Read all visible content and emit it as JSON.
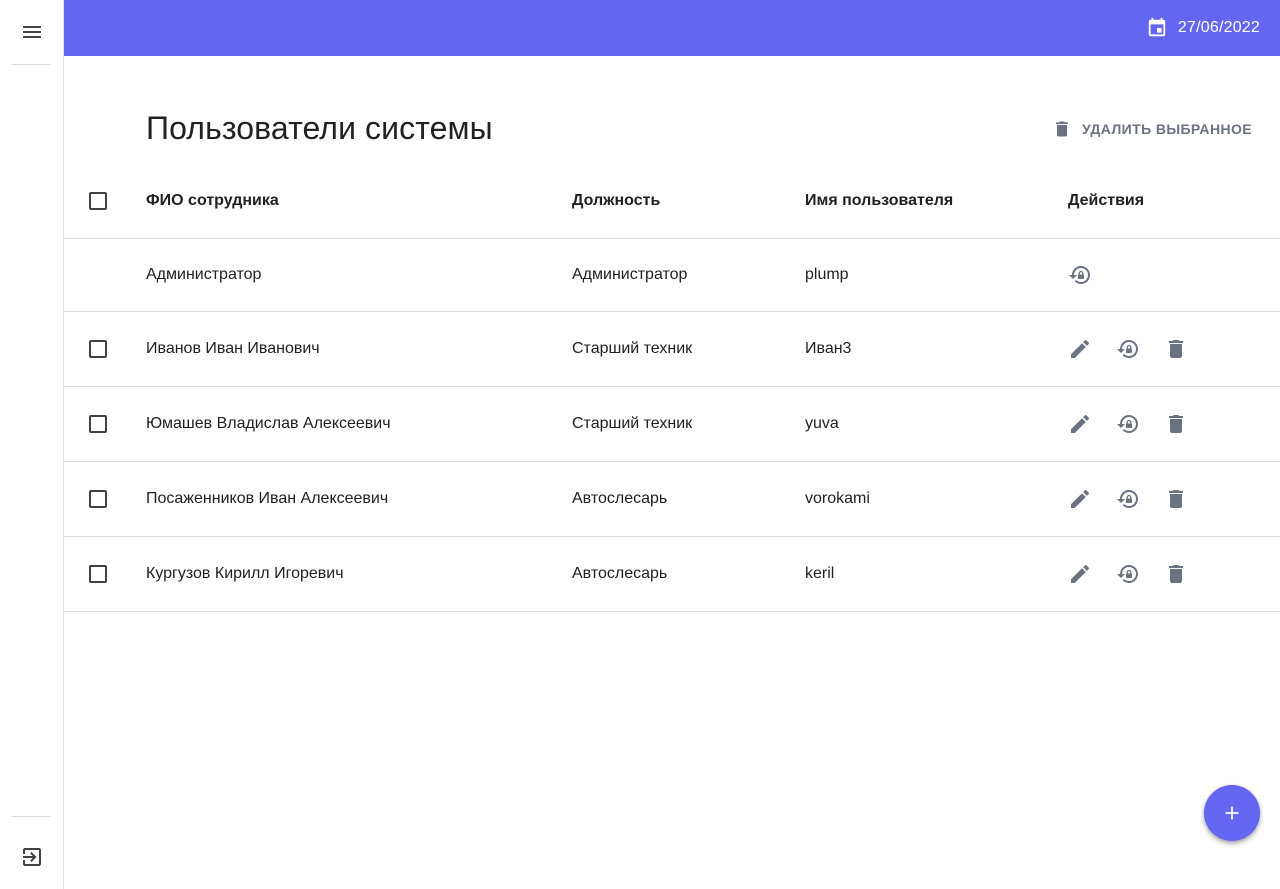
{
  "header": {
    "date": "27/06/2022"
  },
  "page": {
    "title": "Пользователи системы",
    "delete_selected_label": "УДАЛИТЬ ВЫБРАННОЕ"
  },
  "table": {
    "columns": {
      "name": "ФИО сотрудника",
      "position": "Должность",
      "username": "Имя пользователя",
      "actions": "Действия"
    },
    "rows": [
      {
        "name": "Администратор",
        "position": "Администратор",
        "username": "plump",
        "selectable": false
      },
      {
        "name": "Иванов Иван Иванович",
        "position": "Старший техник",
        "username": "Иван3",
        "selectable": true
      },
      {
        "name": "Юмашев Владислав Алексеевич",
        "position": "Старший техник",
        "username": "yuva",
        "selectable": true
      },
      {
        "name": "Посаженников Иван Алексеевич",
        "position": "Автослесарь",
        "username": "vorokami",
        "selectable": true
      },
      {
        "name": "Кургузов Кирилл Игоревич",
        "position": "Автослесарь",
        "username": "keril",
        "selectable": true
      }
    ]
  },
  "colors": {
    "accent": "#6366f1",
    "icon_grey": "#6b7280"
  },
  "icons": {
    "menu": "menu-icon",
    "logout": "logout-icon",
    "calendar": "calendar-icon",
    "delete": "trash-icon",
    "edit": "pencil-icon",
    "reset_password": "lock-reset-icon",
    "add": "plus-icon"
  }
}
